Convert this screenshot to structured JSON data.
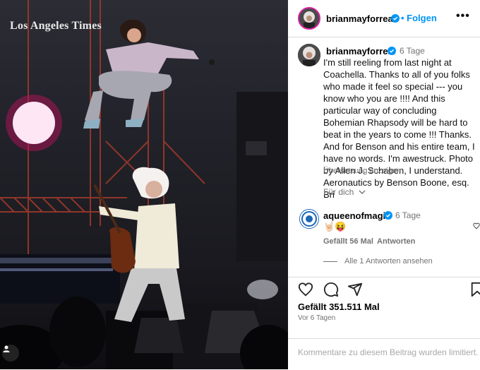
{
  "photo": {
    "watermark": "Los Angeles Times"
  },
  "post": {
    "author": "brianmayforreal",
    "follow_label": "Folgen",
    "more_label": "•••",
    "caption_time": "6 Tage",
    "caption": "I'm still reeling from last night at Coachella. Thanks to all of you folks who made it feel so special --- you know who you are !!!! And this particular way of concluding Bohemian Rhapsody will be hard to beat in the years to come !!! Thanks. And for Benson and his entire team, I have no words. I'm awestruck. Photo by Allen J. Schaben, I understand. Aeronautics by Benson Boone, esq. Bri",
    "translate_label": "Übersetzung anzeigen",
    "see_more_label": "Für dich"
  },
  "comment": {
    "author": "aqueenofmagic",
    "time": "6 Tage",
    "text": "🤘🏻😝",
    "likes": "Gefällt 56 Mal",
    "reply_label": "Antworten",
    "view_replies": "Alle 1 Antworten ansehen"
  },
  "footer": {
    "likes_total": "Gefällt 351.511 Mal",
    "time_ago": "Vor 6 Tagen",
    "comment_placeholder": "Kommentare zu diesem Beitrag wurden limitiert."
  },
  "icons": {
    "verified": "verified-badge-icon",
    "heart": "heart-icon",
    "comment": "comment-icon",
    "share": "share-icon",
    "bookmark": "bookmark-icon",
    "chevron": "chevron-down-icon",
    "user": "user-tag-icon"
  },
  "colors": {
    "accent": "#0095f6",
    "verified": "#0095f6",
    "muted": "#737373",
    "border": "#dbdbdb"
  }
}
